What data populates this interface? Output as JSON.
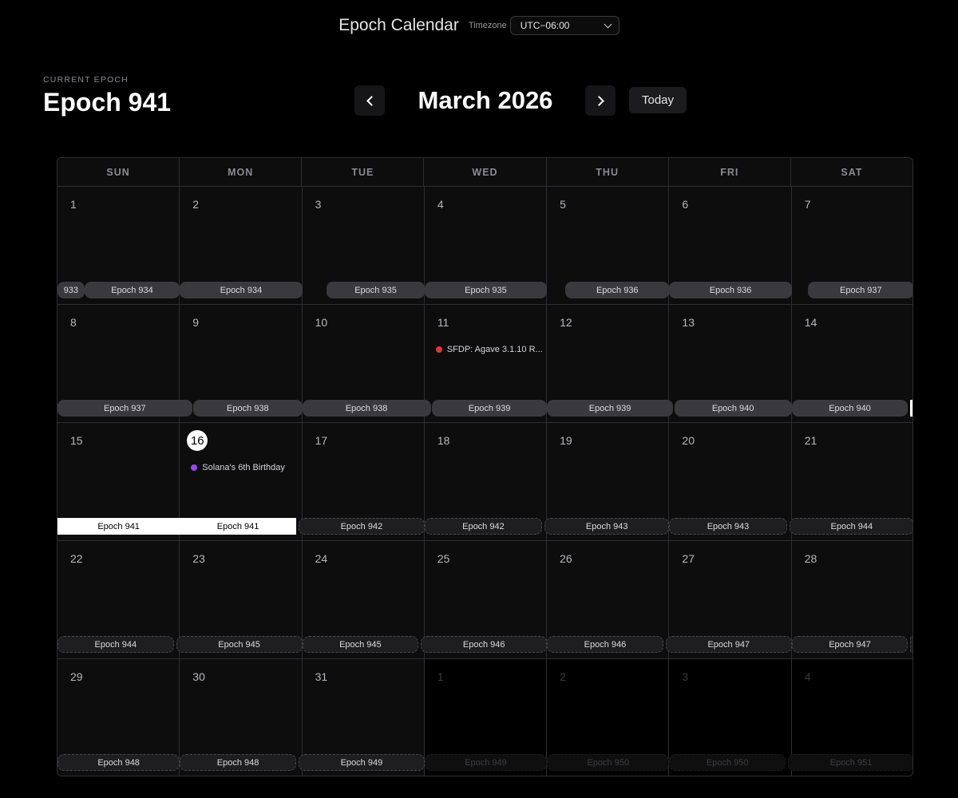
{
  "header": {
    "app_title": "Epoch Calendar",
    "timezone_label": "Timezone",
    "timezone_value": "UTC−06:00"
  },
  "current_epoch": {
    "label": "CURRENT EPOCH",
    "value": "Epoch 941"
  },
  "nav": {
    "month_title": "March 2026",
    "today_label": "Today"
  },
  "weekdays": [
    "SUN",
    "MON",
    "TUE",
    "WED",
    "THU",
    "FRI",
    "SAT"
  ],
  "weeks": [
    {
      "days": [
        {
          "num": "1"
        },
        {
          "num": "2"
        },
        {
          "num": "3"
        },
        {
          "num": "4"
        },
        {
          "num": "5"
        },
        {
          "num": "6"
        },
        {
          "num": "7"
        }
      ],
      "pills": [
        {
          "label": "933",
          "start": 0,
          "span": 0.22,
          "type": "past"
        },
        {
          "label": "Epoch 934",
          "start": 0.22,
          "span": 0.78,
          "type": "past"
        },
        {
          "label": "Epoch 934",
          "start": 1,
          "span": 1,
          "type": "past"
        },
        {
          "label": "Epoch 935",
          "start": 2.2,
          "span": 0.8,
          "type": "past"
        },
        {
          "label": "Epoch 935",
          "start": 3,
          "span": 1,
          "type": "past"
        },
        {
          "label": "Epoch 936",
          "start": 4.15,
          "span": 0.85,
          "type": "past"
        },
        {
          "label": "Epoch 936",
          "start": 5,
          "span": 1,
          "type": "past"
        },
        {
          "label": "Epoch 937",
          "start": 6.13,
          "span": 0.87,
          "type": "past"
        }
      ]
    },
    {
      "days": [
        {
          "num": "8"
        },
        {
          "num": "9"
        },
        {
          "num": "10"
        },
        {
          "num": "11",
          "event": {
            "text": "SFDP: Agave 3.1.10 R...",
            "color": "#e5333b"
          }
        },
        {
          "num": "12"
        },
        {
          "num": "13"
        },
        {
          "num": "14"
        }
      ],
      "pills": [
        {
          "label": "Epoch 937",
          "start": 0,
          "span": 1.1,
          "type": "past"
        },
        {
          "label": "Epoch 938",
          "start": 1.11,
          "span": 0.89,
          "type": "past"
        },
        {
          "label": "Epoch 938",
          "start": 2,
          "span": 1.05,
          "type": "past"
        },
        {
          "label": "Epoch 939",
          "start": 3.06,
          "span": 0.94,
          "type": "past"
        },
        {
          "label": "Epoch 939",
          "start": 4,
          "span": 1.03,
          "type": "past"
        },
        {
          "label": "Epoch 940",
          "start": 5.04,
          "span": 0.96,
          "type": "past"
        },
        {
          "label": "Epoch 940",
          "start": 6,
          "span": 0.95,
          "type": "past"
        },
        {
          "label": "",
          "start": 6.97,
          "span": 0.04,
          "type": "current"
        }
      ]
    },
    {
      "days": [
        {
          "num": "15"
        },
        {
          "num": "16",
          "today": true,
          "event": {
            "text": "Solana's 6th Birthday",
            "color": "#9945ff"
          }
        },
        {
          "num": "17"
        },
        {
          "num": "18"
        },
        {
          "num": "19"
        },
        {
          "num": "20"
        },
        {
          "num": "21"
        }
      ],
      "pills": [
        {
          "label": "Epoch 941",
          "start": 0,
          "span": 1,
          "type": "current"
        },
        {
          "label": "Epoch 941",
          "start": 1,
          "span": 0.95,
          "type": "current"
        },
        {
          "label": "Epoch 942",
          "start": 1.97,
          "span": 1.03,
          "type": "future"
        },
        {
          "label": "Epoch 942",
          "start": 3,
          "span": 0.96,
          "type": "future"
        },
        {
          "label": "Epoch 943",
          "start": 3.98,
          "span": 1.02,
          "type": "future"
        },
        {
          "label": "Epoch 943",
          "start": 5,
          "span": 0.96,
          "type": "future"
        },
        {
          "label": "Epoch 944",
          "start": 5.98,
          "span": 1.02,
          "type": "future"
        }
      ]
    },
    {
      "days": [
        {
          "num": "22"
        },
        {
          "num": "23"
        },
        {
          "num": "24"
        },
        {
          "num": "25"
        },
        {
          "num": "26"
        },
        {
          "num": "27"
        },
        {
          "num": "28"
        }
      ],
      "pills": [
        {
          "label": "Epoch 944",
          "start": 0,
          "span": 0.95,
          "type": "future"
        },
        {
          "label": "Epoch 945",
          "start": 0.97,
          "span": 1.03,
          "type": "future"
        },
        {
          "label": "Epoch 945",
          "start": 2,
          "span": 0.95,
          "type": "future"
        },
        {
          "label": "Epoch 946",
          "start": 2.97,
          "span": 1.03,
          "type": "future"
        },
        {
          "label": "Epoch 946",
          "start": 4,
          "span": 0.95,
          "type": "future"
        },
        {
          "label": "Epoch 947",
          "start": 4.97,
          "span": 1.03,
          "type": "future"
        },
        {
          "label": "Epoch 947",
          "start": 6,
          "span": 0.95,
          "type": "future"
        },
        {
          "label": "",
          "start": 6.97,
          "span": 0.04,
          "type": "future"
        }
      ]
    },
    {
      "days": [
        {
          "num": "29"
        },
        {
          "num": "30"
        },
        {
          "num": "31"
        },
        {
          "num": "1",
          "out": true
        },
        {
          "num": "2",
          "out": true
        },
        {
          "num": "3",
          "out": true
        },
        {
          "num": "4",
          "out": true
        }
      ],
      "pills": [
        {
          "label": "Epoch 948",
          "start": 0,
          "span": 1,
          "type": "future"
        },
        {
          "label": "Epoch 948",
          "start": 1,
          "span": 0.95,
          "type": "future"
        },
        {
          "label": "Epoch 949",
          "start": 1.97,
          "span": 1.03,
          "type": "future"
        },
        {
          "label": "Epoch 949",
          "start": 3,
          "span": 1,
          "type": "dim"
        },
        {
          "label": "Epoch 950",
          "start": 4,
          "span": 1,
          "type": "dim"
        },
        {
          "label": "Epoch 950",
          "start": 5,
          "span": 0.95,
          "type": "dim"
        },
        {
          "label": "Epoch 951",
          "start": 5.97,
          "span": 1.03,
          "type": "dim"
        }
      ]
    }
  ]
}
